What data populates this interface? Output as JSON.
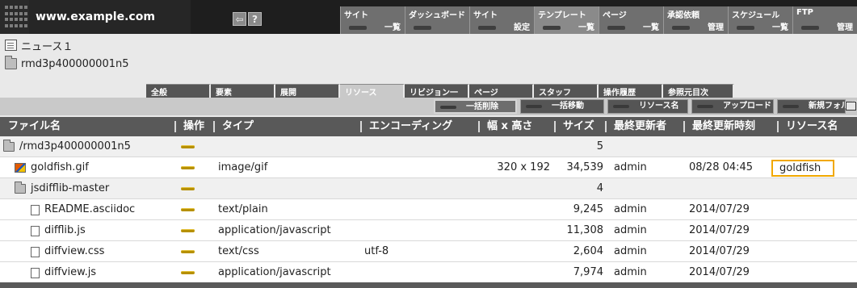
{
  "header": {
    "site_url": "www.example.com",
    "home_icon": "home-icon",
    "help_label": "?"
  },
  "menu": [
    {
      "top": "サイト",
      "sub": "一覧"
    },
    {
      "top": "ダッシュボード",
      "sub": ""
    },
    {
      "top": "サイト",
      "sub": "設定"
    },
    {
      "top": "テンプレート",
      "sub": "一覧"
    },
    {
      "top": "ページ",
      "sub": "一覧"
    },
    {
      "top": "承認依頼",
      "sub": "管理"
    },
    {
      "top": "スケジュール",
      "sub": "一覧"
    },
    {
      "top": "FTP",
      "sub": "管理"
    }
  ],
  "breadcrumb": {
    "page_name": "ニュース１",
    "folder_name": "rmd3p400000001n5"
  },
  "tabs": [
    "全般",
    "要素",
    "展開",
    "リソース",
    "リビジョン一覧",
    "ページ",
    "スタッフ",
    "操作履歴",
    "参照元目次"
  ],
  "active_tab": 3,
  "actions": {
    "bulk_delete": "一括削除",
    "bulk_move": "一括移動",
    "resource_name": "リソース名",
    "upload": "アップロード",
    "new_folder": "新規フォルダ"
  },
  "columns": {
    "filename": "ファイル名",
    "ops": "操作",
    "type": "タイプ",
    "encoding": "エンコーディング",
    "dimensions": "幅 x 高さ",
    "size": "サイズ",
    "last_updater": "最終更新者",
    "last_updated": "最終更新時刻",
    "resource_name": "リソース名"
  },
  "rows": [
    {
      "name": "/rmd3p400000001n5",
      "type": "",
      "encoding": "",
      "dims": "",
      "size": "5",
      "updater": "",
      "updated": "",
      "resource": ""
    },
    {
      "name": "goldfish.gif",
      "type": "image/gif",
      "encoding": "",
      "dims": "320 x 192",
      "size": "34,539",
      "updater": "admin",
      "updated": "08/28 04:45",
      "resource": "goldfish"
    },
    {
      "name": "jsdifflib-master",
      "type": "",
      "encoding": "",
      "dims": "",
      "size": "4",
      "updater": "",
      "updated": "",
      "resource": ""
    },
    {
      "name": "README.asciidoc",
      "type": "text/plain",
      "encoding": "",
      "dims": "",
      "size": "9,245",
      "updater": "admin",
      "updated": "2014/07/29",
      "resource": ""
    },
    {
      "name": "difflib.js",
      "type": "application/javascript",
      "encoding": "",
      "dims": "",
      "size": "11,308",
      "updater": "admin",
      "updated": "2014/07/29",
      "resource": ""
    },
    {
      "name": "diffview.css",
      "type": "text/css",
      "encoding": "utf-8",
      "dims": "",
      "size": "2,604",
      "updater": "admin",
      "updated": "2014/07/29",
      "resource": ""
    },
    {
      "name": "diffview.js",
      "type": "application/javascript",
      "encoding": "",
      "dims": "",
      "size": "7,974",
      "updater": "admin",
      "updated": "2014/07/29",
      "resource": ""
    }
  ],
  "colors": {
    "accent": "#f1a800",
    "header_bg": "#1e1e1e",
    "table_header_bg": "#595959"
  }
}
